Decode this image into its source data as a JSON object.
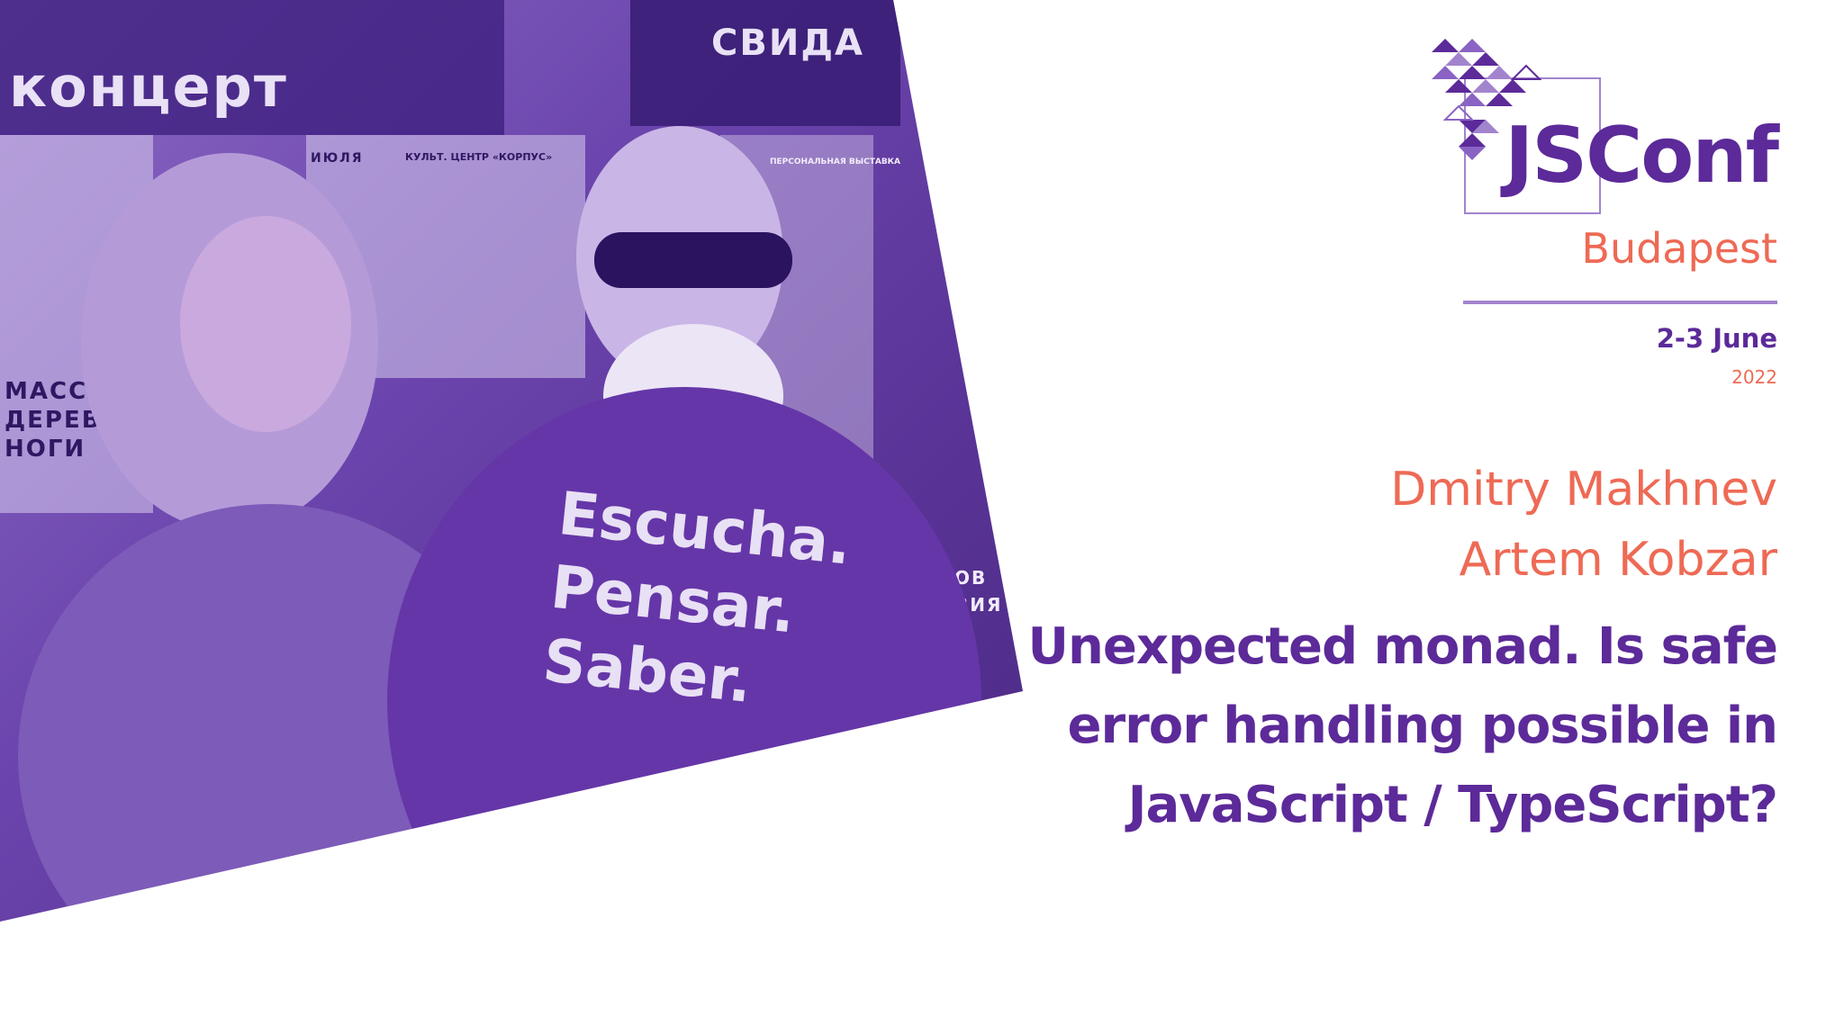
{
  "conference": {
    "name": "JSConf",
    "city": "Budapest",
    "dates": "2-3 June",
    "year": "2022"
  },
  "speakers": [
    "Dmitry Makhnev",
    "Artem Kobzar"
  ],
  "talk": {
    "title_lines": [
      "Unexpected monad. Is safe",
      "error handling possible in",
      "JavaScript / TypeScript?"
    ]
  },
  "photo": {
    "shirt_lines": [
      "Escucha.",
      "Pensar.",
      "Saber."
    ],
    "poster_texts": [
      "концерт",
      "СВИДА",
      "МАССАЖ",
      "ДЕРЕВЯНН",
      "НОГИ",
      "ИЮЛЯ",
      "КУЛЬТ. ЦЕНТР «КОРПУС»",
      "ПЕРСОНАЛЬНАЯ ВЫСТАВКА",
      "ОВ",
      "ВИЯ"
    ]
  },
  "colors": {
    "brand_purple": "#5c2a99",
    "accent_coral": "#ee6a55",
    "rule_lavender": "#a284cd"
  }
}
